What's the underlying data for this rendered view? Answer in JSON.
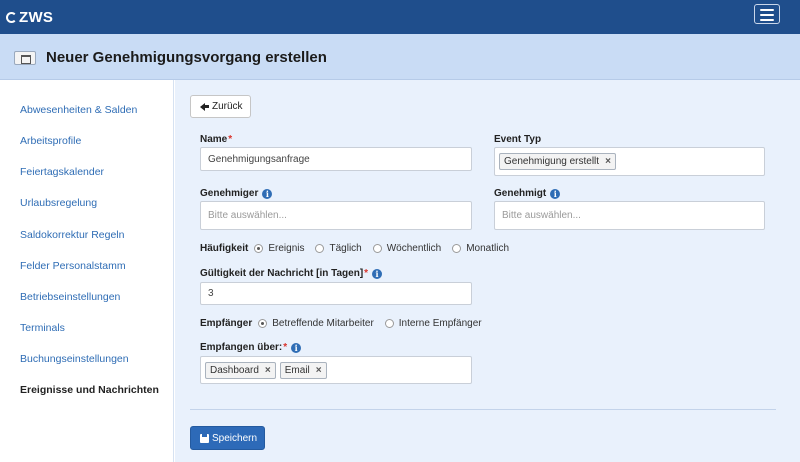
{
  "app": {
    "logo": "ZWS"
  },
  "header": {
    "title": "Neuer Genehmigungsvorgang erstellen"
  },
  "sidebar": {
    "items": [
      {
        "label": "Abwesenheiten & Salden"
      },
      {
        "label": "Arbeitsprofile"
      },
      {
        "label": "Feiertagskalender"
      },
      {
        "label": "Urlaubsregelung"
      },
      {
        "label": "Saldokorrektur Regeln"
      },
      {
        "label": "Felder Personalstamm"
      },
      {
        "label": "Betriebseinstellungen"
      },
      {
        "label": "Terminals"
      },
      {
        "label": "Buchungseinstellungen"
      },
      {
        "label": "Ereignisse und Nachrichten",
        "active": true
      }
    ]
  },
  "form": {
    "back_label": "Zurück",
    "name": {
      "label": "Name",
      "required_mark": "*",
      "value": "Genehmigungsanfrage"
    },
    "event_type": {
      "label": "Event Typ",
      "tags": [
        "Genehmigung erstellt"
      ]
    },
    "approver": {
      "label": "Genehmiger",
      "placeholder": "Bitte auswählen...",
      "info_icon": "info-icon"
    },
    "approved": {
      "label": "Genehmigt",
      "placeholder": "Bitte auswählen...",
      "info_icon": "info-icon"
    },
    "frequency": {
      "label": "Häufigkeit",
      "options": [
        "Ereignis",
        "Täglich",
        "Wöchentlich",
        "Monatlich"
      ],
      "selected": "Ereignis"
    },
    "validity": {
      "label": "Gültigkeit der Nachricht [in Tagen]",
      "required_mark": "*",
      "value": "3"
    },
    "recipient": {
      "label": "Empfänger",
      "options": [
        "Betreffende Mitarbeiter",
        "Interne Empfänger"
      ],
      "selected": "Betreffende Mitarbeiter"
    },
    "receive_via": {
      "label": "Empfangen über:",
      "required_mark": "*",
      "tags": [
        "Dashboard",
        "Email"
      ]
    },
    "save_label": "Speichern",
    "tag_remove": "×"
  },
  "colors": {
    "topbar": "#1f4e8c",
    "titlebar": "#c9dcf5",
    "main_bg": "#e9f1fc",
    "link": "#2f6db5",
    "primary_button": "#2d6ab8",
    "required": "#d9342b"
  }
}
